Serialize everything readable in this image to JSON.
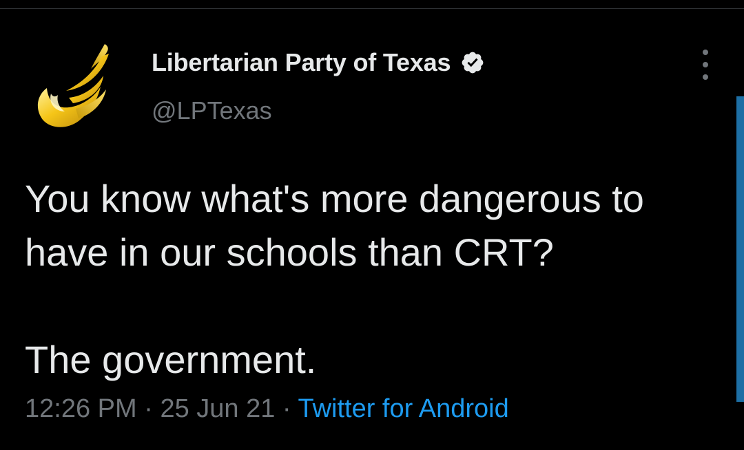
{
  "tweet": {
    "author": {
      "name": "Libertarian Party of Texas",
      "handle": "@LPTexas",
      "verified": true,
      "avatar_icon": "golden-torch-logo-icon"
    },
    "text_line_1": "You know what's more dangerous to have in our schools than CRT?",
    "text_line_2": "The government.",
    "time": "12:26 PM",
    "separator": "·",
    "date": "25 Jun 21",
    "source": "Twitter for Android",
    "more_icon": "more-vertical-icon"
  },
  "colors": {
    "background": "#000000",
    "primary_text": "#e7e9ea",
    "secondary_text": "#71767b",
    "link": "#1d9bf0",
    "verified_badge": "#e7e9ea",
    "scroll_indicator": "#1d6fa5"
  }
}
